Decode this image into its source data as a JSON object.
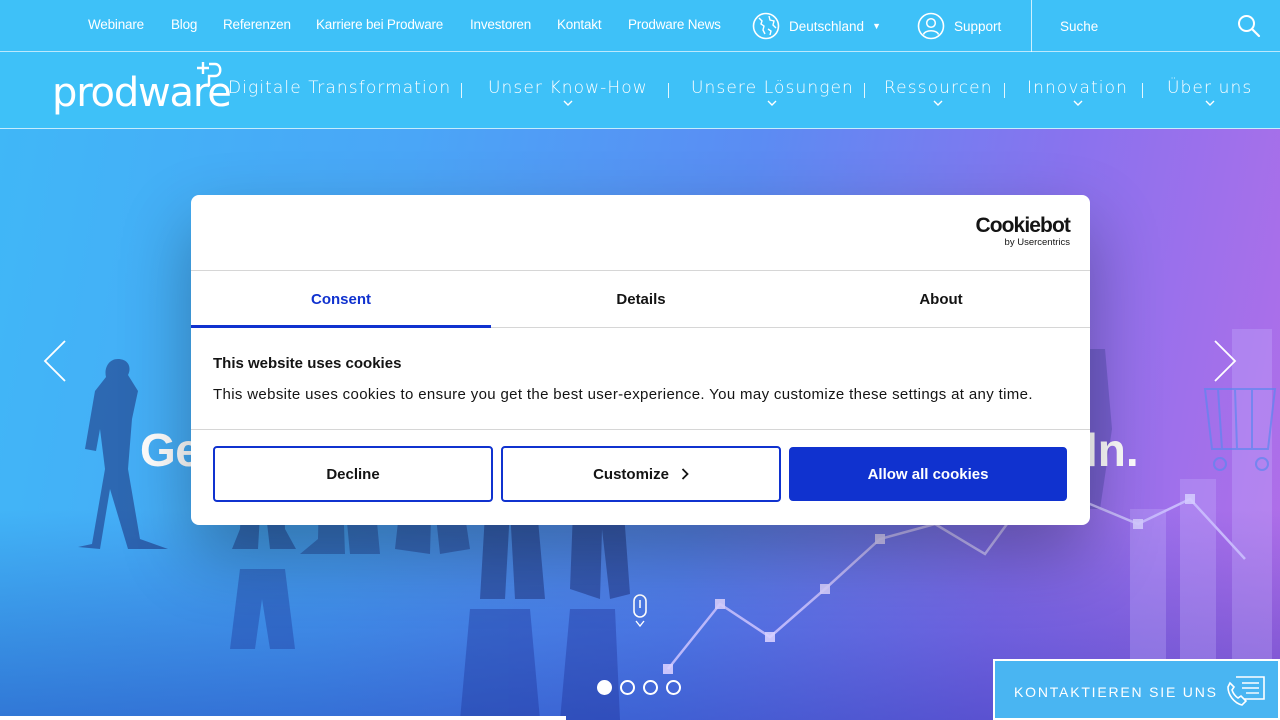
{
  "topbar": {
    "links": [
      "Webinare",
      "Blog",
      "Referenzen",
      "Karriere bei Prodware",
      "Investoren",
      "Kontakt",
      "Prodware News"
    ],
    "country": "Deutschland",
    "support": "Support",
    "search_placeholder": "Suche"
  },
  "nav": {
    "logo_text": "prodware",
    "items": [
      {
        "label": "Digitale Transformation"
      },
      {
        "label": "Unser Know-How"
      },
      {
        "label": "Unsere Lösungen"
      },
      {
        "label": "Ressourcen"
      },
      {
        "label": "Innovation"
      },
      {
        "label": "Über uns"
      }
    ]
  },
  "hero": {
    "headline_start": "Ge",
    "headline_end": "ln.",
    "slide_count": 4,
    "active_slide": 1,
    "contact_label": "KONTAKTIEREN SIE UNS"
  },
  "cookie": {
    "brand": "Cookiebot",
    "brand_by": "by Usercentrics",
    "tabs": [
      "Consent",
      "Details",
      "About"
    ],
    "active_tab": "Consent",
    "title": "This website uses cookies",
    "text": "This website uses cookies to ensure you get the best user-experience. You may customize these settings at any time.",
    "decline": "Decline",
    "customize": "Customize",
    "allow": "Allow all cookies"
  },
  "colors": {
    "header_bg": "#3ec1f8",
    "accent_blue": "#1032cf",
    "text_dark": "#141414"
  }
}
